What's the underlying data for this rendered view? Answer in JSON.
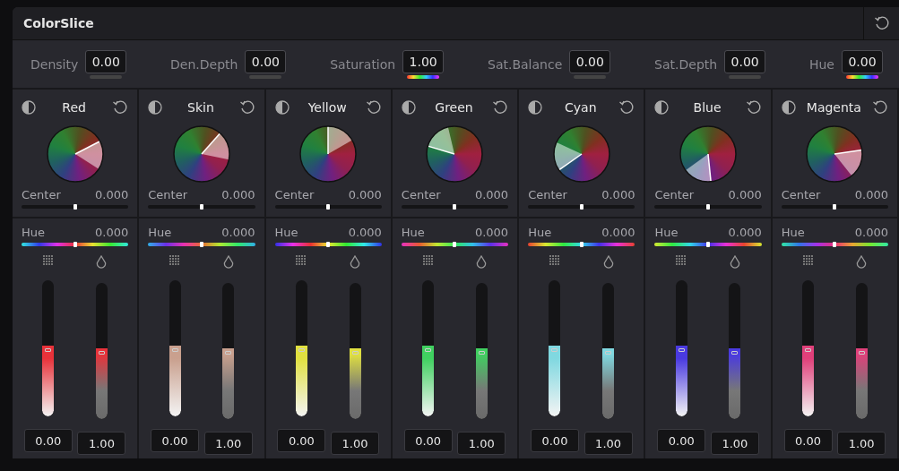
{
  "window": {
    "title": "ColorSlice"
  },
  "params": [
    {
      "label": "Density",
      "value": "0.00",
      "kind": "plain"
    },
    {
      "label": "Den.Depth",
      "value": "0.00",
      "kind": "plain"
    },
    {
      "label": "Saturation",
      "value": "1.00",
      "kind": "rainbow"
    },
    {
      "label": "Sat.Balance",
      "value": "0.00",
      "kind": "plain"
    },
    {
      "label": "Sat.Depth",
      "value": "0.00",
      "kind": "plain"
    },
    {
      "label": "Hue",
      "value": "0.00",
      "kind": "rainbow"
    }
  ],
  "columns": [
    {
      "name": "Red",
      "color": "#e8323a",
      "center": {
        "label": "Center",
        "value": "0.000",
        "level": 0.5
      },
      "hue": {
        "label": "Hue",
        "value": "0.000",
        "level": 0.5
      },
      "sliders": [
        {
          "value": "0.00",
          "level": 0.52
        },
        {
          "value": "1.00",
          "level": 0.52
        }
      ]
    },
    {
      "name": "Skin",
      "color": "#c9a08e",
      "center": {
        "label": "Center",
        "value": "0.000",
        "level": 0.5
      },
      "hue": {
        "label": "Hue",
        "value": "0.000",
        "level": 0.5
      },
      "sliders": [
        {
          "value": "0.00",
          "level": 0.52
        },
        {
          "value": "1.00",
          "level": 0.52
        }
      ]
    },
    {
      "name": "Yellow",
      "color": "#e0e040",
      "center": {
        "label": "Center",
        "value": "0.000",
        "level": 0.5
      },
      "hue": {
        "label": "Hue",
        "value": "0.000",
        "level": 0.5
      },
      "sliders": [
        {
          "value": "0.00",
          "level": 0.52
        },
        {
          "value": "1.00",
          "level": 0.52
        }
      ]
    },
    {
      "name": "Green",
      "color": "#40d060",
      "center": {
        "label": "Center",
        "value": "0.000",
        "level": 0.5
      },
      "hue": {
        "label": "Hue",
        "value": "0.000",
        "level": 0.5
      },
      "sliders": [
        {
          "value": "0.00",
          "level": 0.52
        },
        {
          "value": "1.00",
          "level": 0.52
        }
      ]
    },
    {
      "name": "Cyan",
      "color": "#80d8e0",
      "center": {
        "label": "Center",
        "value": "0.000",
        "level": 0.5
      },
      "hue": {
        "label": "Hue",
        "value": "0.000",
        "level": 0.5
      },
      "sliders": [
        {
          "value": "0.00",
          "level": 0.52
        },
        {
          "value": "1.00",
          "level": 0.52
        }
      ]
    },
    {
      "name": "Blue",
      "color": "#4a3ae0",
      "center": {
        "label": "Center",
        "value": "0.000",
        "level": 0.5
      },
      "hue": {
        "label": "Hue",
        "value": "0.000",
        "level": 0.5
      },
      "sliders": [
        {
          "value": "0.00",
          "level": 0.52
        },
        {
          "value": "1.00",
          "level": 0.52
        }
      ]
    },
    {
      "name": "Magenta",
      "color": "#e0407a",
      "center": {
        "label": "Center",
        "value": "0.000",
        "level": 0.5
      },
      "hue": {
        "label": "Hue",
        "value": "0.000",
        "level": 0.5
      },
      "sliders": [
        {
          "value": "0.00",
          "level": 0.52
        },
        {
          "value": "1.00",
          "level": 0.52
        }
      ]
    }
  ]
}
